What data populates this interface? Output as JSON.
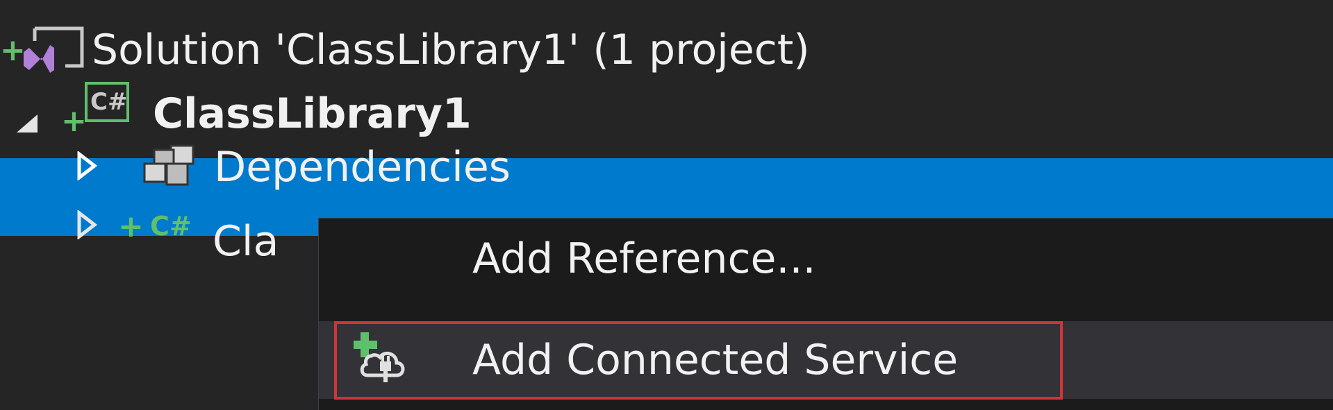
{
  "tree": {
    "solution": {
      "plus": "+",
      "label": "Solution 'ClassLibrary1' (1 project)"
    },
    "project": {
      "plus": "+",
      "cs_badge": "C#",
      "label": "ClassLibrary1"
    },
    "dependencies": {
      "label": "Dependencies"
    },
    "classfile": {
      "plus": "+",
      "cs_badge": "C#",
      "label": "Cla"
    }
  },
  "context_menu": {
    "items": [
      {
        "label": "Add Reference..."
      },
      {
        "label": "Add Connected Service"
      }
    ]
  },
  "colors": {
    "background": "#252526",
    "selection": "#007acc",
    "menu_background": "#1b1b1c",
    "menu_hover": "#333337",
    "highlight_border": "#d13438",
    "vs_purple": "#b180d7",
    "csharp_green": "#5fbf6a"
  },
  "icons": {
    "solution": "visual-studio-solution-icon",
    "project": "csharp-project-icon",
    "dependencies": "dependencies-icon",
    "connected_service": "add-connected-service-icon",
    "expanded": "triangle-expanded-icon",
    "collapsed": "triangle-collapsed-icon"
  }
}
